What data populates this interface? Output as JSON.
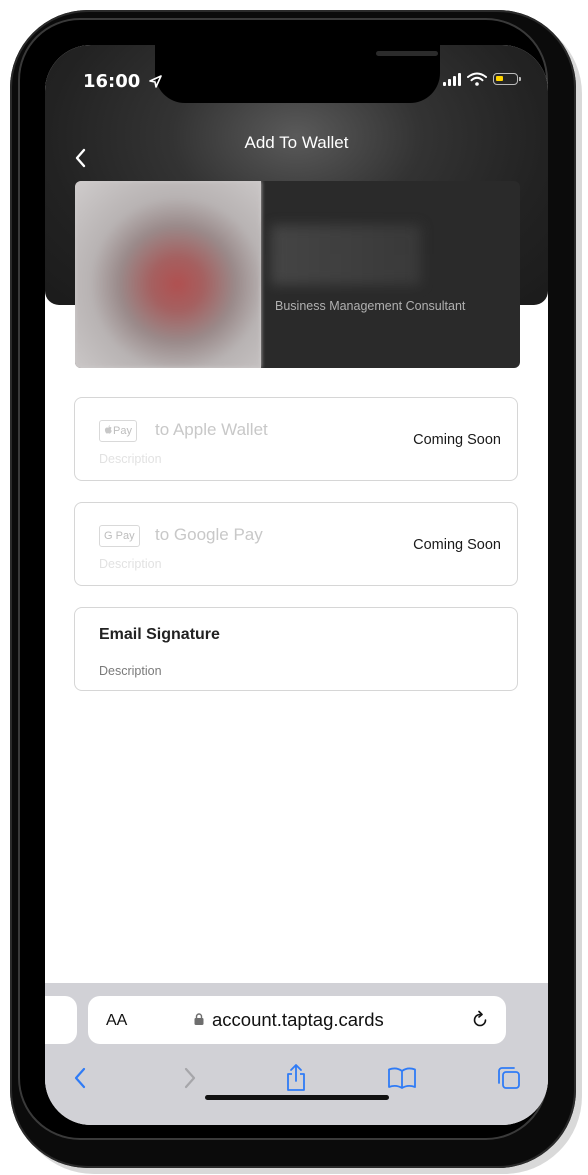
{
  "status_bar": {
    "time": "16:00"
  },
  "header": {
    "title": "Add To Wallet"
  },
  "profile": {
    "role": "Business Management Consultant"
  },
  "wallet_options": [
    {
      "badge": "Pay",
      "title": "to Apple Wallet",
      "description": "Description",
      "status": "Coming Soon"
    },
    {
      "badge": "G Pay",
      "title": "to Google Pay",
      "description": "Description",
      "status": "Coming Soon"
    }
  ],
  "email_signature": {
    "title": "Email Signature",
    "description": "Description"
  },
  "browser": {
    "text_size_label": "AA",
    "url": "account.taptag.cards"
  },
  "colors": {
    "header_bg": "#2a2a2a",
    "accent_blue": "#2f7bf6",
    "battery_low": "#ffd400"
  }
}
